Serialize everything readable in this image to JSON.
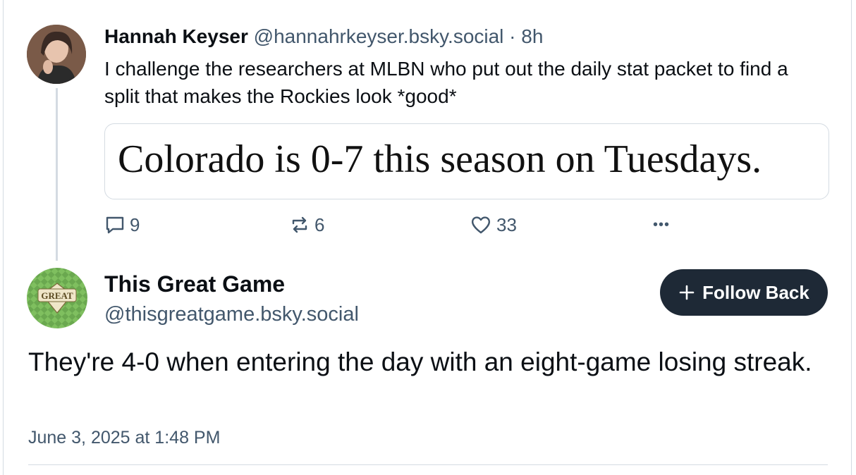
{
  "parent_post": {
    "author_name": "Hannah Keyser",
    "author_handle": "@hannahrkeyser.bsky.social",
    "separator": " · ",
    "age": "8h",
    "text": "I challenge the researchers at MLBN who put out the daily stat packet to find a split that makes the Rockies look *good*",
    "embed_image_text": "Colorado is 0-7 this season on Tuesdays.",
    "stats": {
      "replies": "9",
      "reposts": "6",
      "likes": "33"
    },
    "more_label": "•••"
  },
  "main_post": {
    "author_name": "This Great Game",
    "author_handle": "@thisgreatgame.bsky.social",
    "avatar_logo_text": "GREAT",
    "follow_label": "Follow Back",
    "text": "They're 4-0 when entering the day with an eight-game losing streak.",
    "timestamp": "June 3, 2025 at 1:48 PM"
  },
  "colors": {
    "text_primary": "#0b0f14",
    "text_secondary": "#42576c",
    "border": "#d4dbe2",
    "follow_button_bg": "#1e2936",
    "avatar2_green": "#6aa84f"
  },
  "icons": {
    "reply": "speech-bubble-icon",
    "repost": "repost-arrows-icon",
    "like": "heart-icon",
    "more": "ellipsis-icon",
    "follow": "plus-icon"
  }
}
